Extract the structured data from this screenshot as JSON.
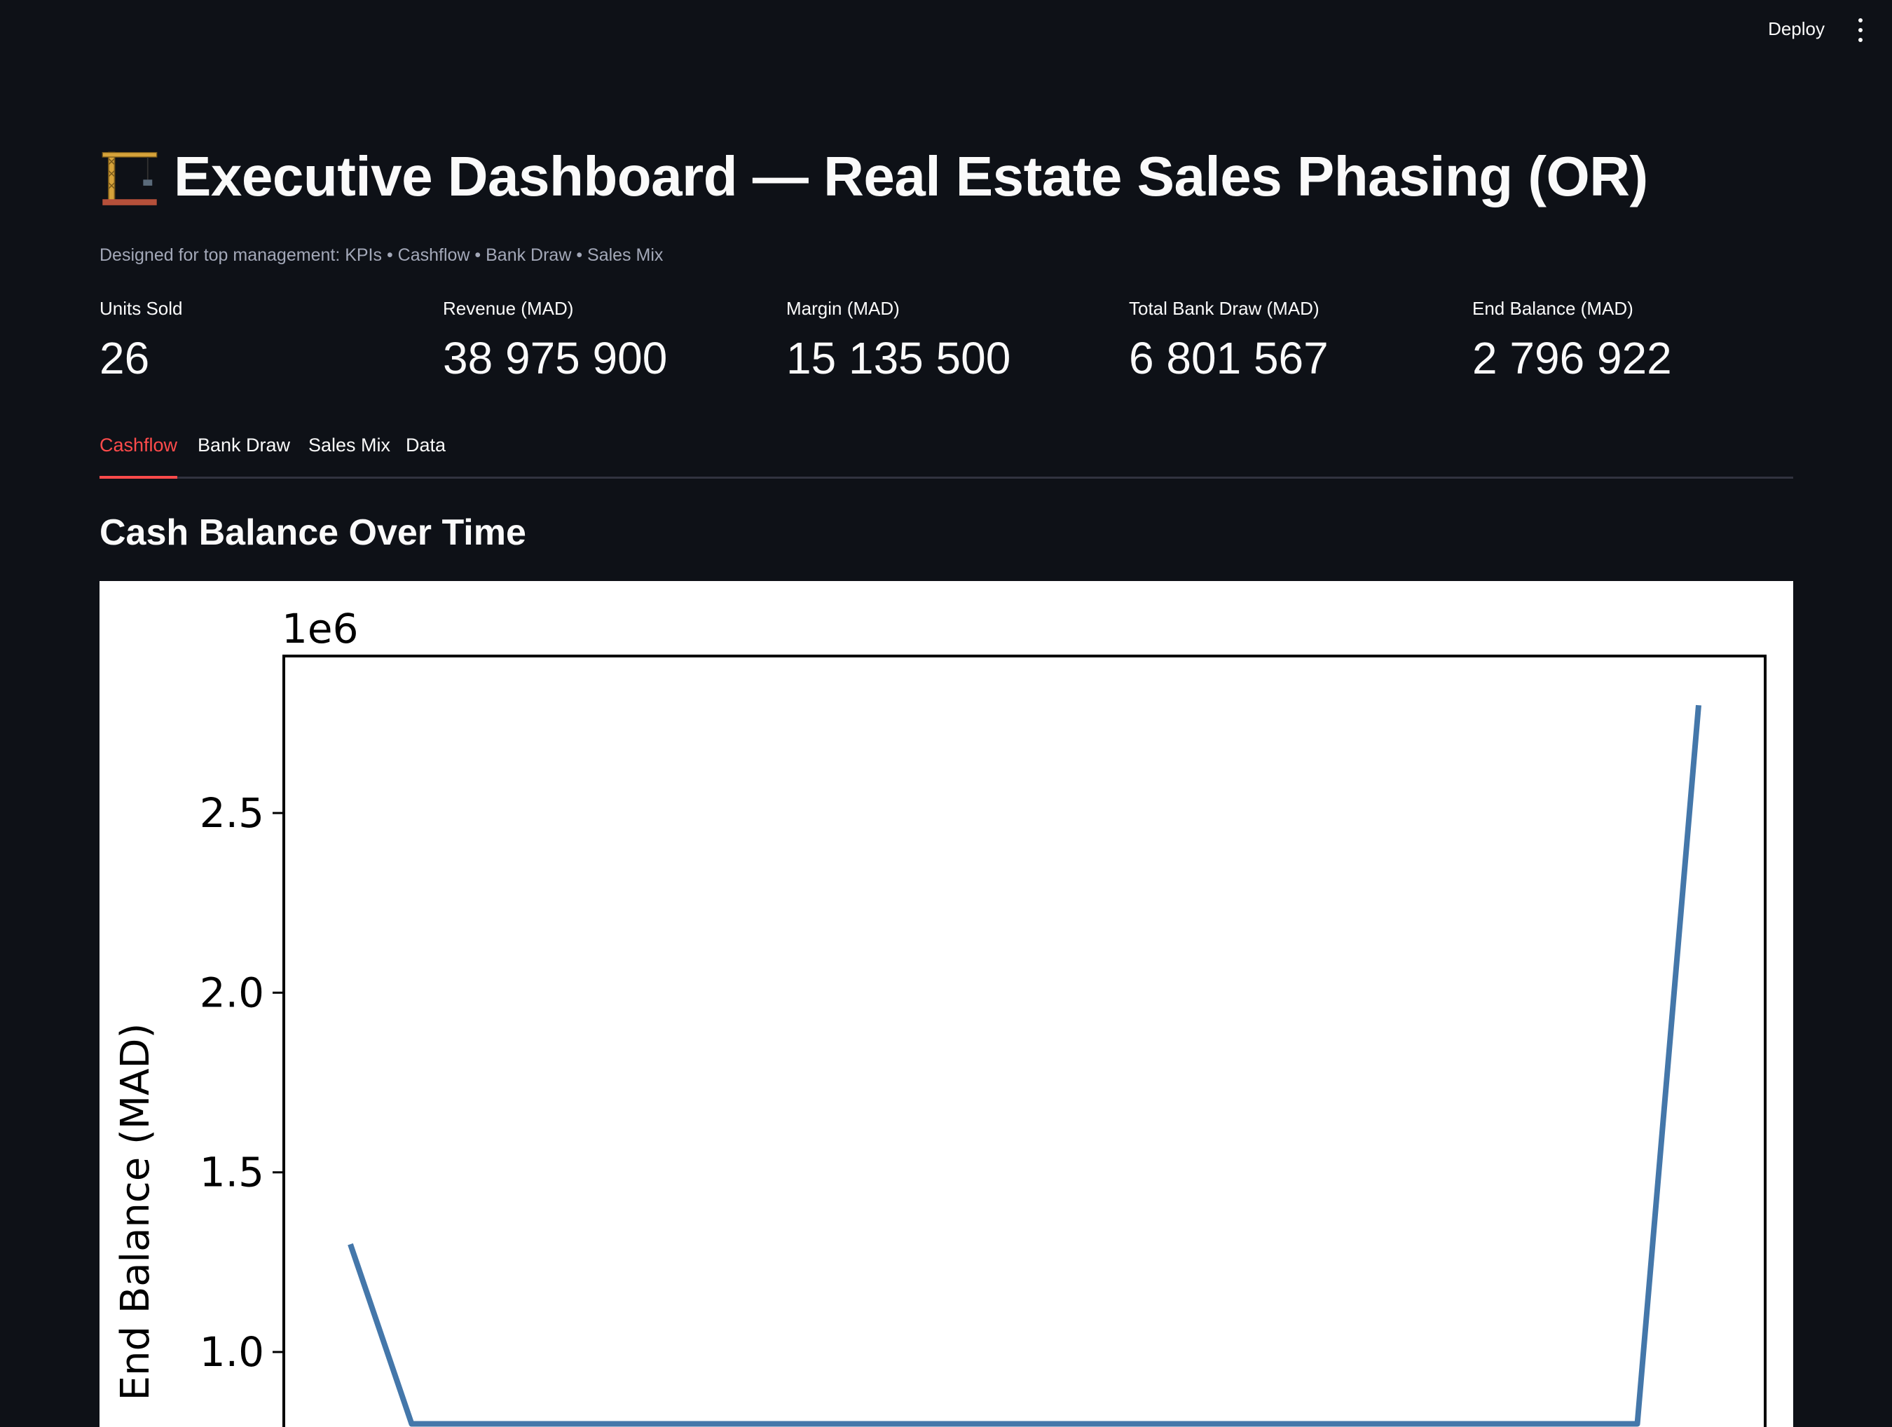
{
  "header": {
    "deploy_label": "Deploy",
    "menu_icon": "kebab-menu-icon"
  },
  "page": {
    "title_icon": "construction-crane-icon",
    "title": "Executive Dashboard — Real Estate Sales Phasing (OR)",
    "subtitle": "Designed for top management: KPIs • Cashflow • Bank Draw • Sales Mix"
  },
  "metrics": [
    {
      "label": "Units Sold",
      "value": "26"
    },
    {
      "label": "Revenue (MAD)",
      "value": "38 975 900"
    },
    {
      "label": "Margin (MAD)",
      "value": "15 135 500"
    },
    {
      "label": "Total Bank Draw (MAD)",
      "value": "6 801 567"
    },
    {
      "label": "End Balance (MAD)",
      "value": "2 796 922"
    }
  ],
  "tabs": [
    {
      "label": "Cashflow",
      "active": true
    },
    {
      "label": "Bank Draw",
      "active": false
    },
    {
      "label": "Sales Mix",
      "active": false
    },
    {
      "label": "Data",
      "active": false
    }
  ],
  "section": {
    "title": "Cash Balance Over Time"
  },
  "colors": {
    "background": "#0e1117",
    "accent": "#ff4b4b",
    "line": "#4477aa",
    "muted_text": "#a3a8b8"
  },
  "chart_data": {
    "type": "line",
    "title": "",
    "ylabel": "End Balance (MAD)",
    "xlabel": "",
    "offset_text": "1e6",
    "y_ticks": [
      "1.0",
      "1.5",
      "2.0",
      "2.5"
    ],
    "y_tick_values": [
      1.0,
      1.5,
      2.0,
      2.5
    ],
    "ylim_visible": [
      0.8,
      2.93
    ],
    "series": [
      {
        "name": "",
        "x": [
          0,
          1,
          21,
          22
        ],
        "y": [
          1.3,
          0.8,
          0.8,
          2.8
        ]
      }
    ]
  }
}
